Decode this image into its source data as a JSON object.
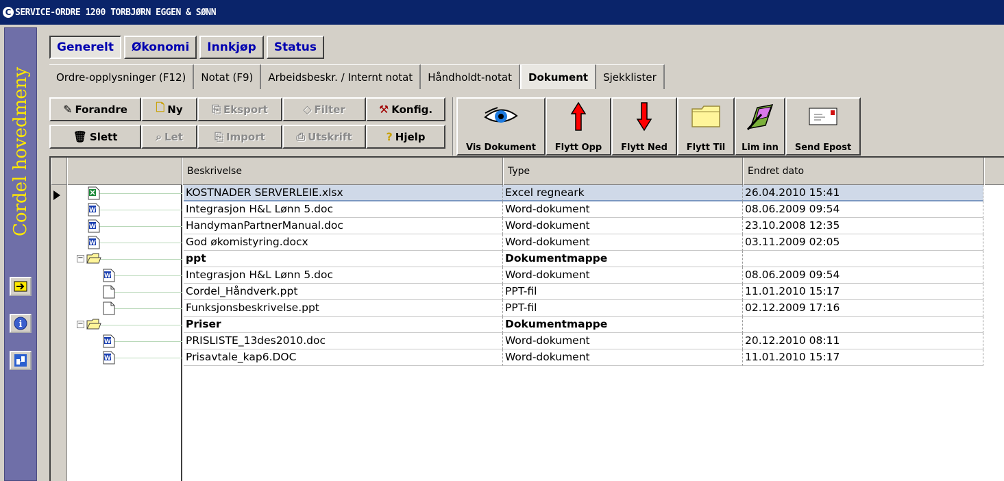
{
  "window": {
    "title": "SERVICE-ORDRE  1200  TORBJØRN EGGEN & SØNN"
  },
  "sidebar": {
    "title": "Cordel hovedmeny",
    "buttons": [
      "arrow-right-icon",
      "info-icon",
      "network-icon"
    ]
  },
  "top_tabs": [
    {
      "label": "Generelt",
      "active": true
    },
    {
      "label": "Økonomi"
    },
    {
      "label": "Innkjøp"
    },
    {
      "label": "Status"
    }
  ],
  "sub_tabs": [
    {
      "label": "Ordre-opplysninger (F12)"
    },
    {
      "label": "Notat (F9)"
    },
    {
      "label": "Arbeidsbeskr. / Internt notat"
    },
    {
      "label": "Håndholdt-notat"
    },
    {
      "label": "Dokument",
      "active": true
    },
    {
      "label": "Sjekklister"
    }
  ],
  "toolbar": {
    "forandre": "Forandre",
    "ny": "Ny",
    "eksport": "Eksport",
    "filter": "Filter",
    "konfig": "Konfig.",
    "slett": "Slett",
    "let": "Let",
    "import": "Import",
    "utskrift": "Utskrift",
    "hjelp": "Hjelp",
    "vis_dokument": "Vis Dokument",
    "flytt_opp": "Flytt Opp",
    "flytt_ned": "Flytt Ned",
    "flytt_til": "Flytt Til",
    "lim_inn": "Lim inn",
    "send_epost": "Send Epost"
  },
  "grid": {
    "columns": [
      "Beskrivelse",
      "Type",
      "Endret dato"
    ],
    "rows": [
      {
        "name": "KOSTNADER SERVERLEIE.xlsx",
        "type": "Excel regneark",
        "date": "26.04.2010 15:41",
        "icon": "excel-icon"
      },
      {
        "name": "Integrasjon H&L Lønn 5.doc",
        "type": "Word-dokument",
        "date": "08.06.2009 09:54",
        "icon": "word-icon"
      },
      {
        "name": "HandymanPartnerManual.doc",
        "type": "Word-dokument",
        "date": "23.10.2008 12:35",
        "icon": "word-icon"
      },
      {
        "name": "God økomistyring.docx",
        "type": "Word-dokument",
        "date": "03.11.2009 02:05",
        "icon": "word-icon"
      },
      {
        "name": "ppt",
        "type": "Dokumentmappe",
        "date": "",
        "icon": "folder-icon"
      },
      {
        "name": "Integrasjon H&L Lønn 5.doc",
        "type": "Word-dokument",
        "date": "08.06.2009 09:54",
        "icon": "word-icon"
      },
      {
        "name": "Cordel_Håndverk.ppt",
        "type": "PPT-fil",
        "date": "11.01.2010 15:17",
        "icon": "file-icon"
      },
      {
        "name": "Funksjonsbeskrivelse.ppt",
        "type": "PPT-fil",
        "date": "02.12.2009 17:16",
        "icon": "file-icon"
      },
      {
        "name": "Priser",
        "type": "Dokumentmappe",
        "date": "",
        "icon": "folder-icon"
      },
      {
        "name": "PRISLISTE_13des2010.doc",
        "type": "Word-dokument",
        "date": "20.12.2010 08:11",
        "icon": "word-icon"
      },
      {
        "name": "Prisavtale_kap6.DOC",
        "type": "Word-dokument",
        "date": "11.01.2010 15:17",
        "icon": "word-icon"
      }
    ]
  },
  "colors": {
    "titlebar": "#0a246a",
    "sidebar": "#6f6fa8",
    "sidebar_text": "#ffe800",
    "tab_text": "#0000b0",
    "selection": "#cfd9e8"
  }
}
